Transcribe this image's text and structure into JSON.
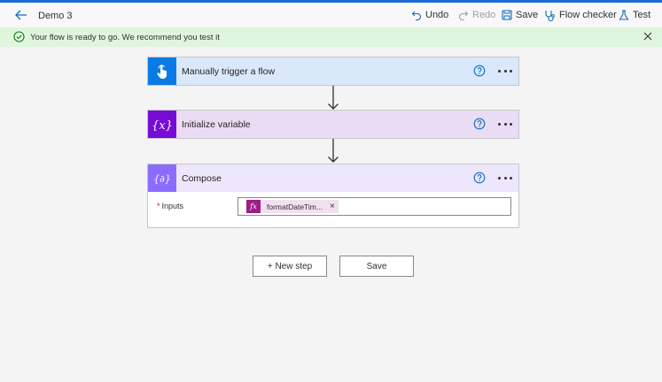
{
  "header": {
    "title": "Demo 3",
    "commands": {
      "undo": "Undo",
      "redo": "Redo",
      "save": "Save",
      "flow_checker": "Flow checker",
      "test": "Test"
    }
  },
  "banner": {
    "message": "Your flow is ready to go. We recommend you test it"
  },
  "steps": [
    {
      "label": "Manually trigger a flow",
      "icon": "hand-touch-icon"
    },
    {
      "label": "Initialize variable",
      "icon": "variable-icon"
    },
    {
      "label": "Compose",
      "icon": "compose-icon"
    }
  ],
  "compose": {
    "inputs_label": "Inputs",
    "required_mark": "*",
    "token_text": "formatDateTim...",
    "token_icon": "fx",
    "token_remove": "×"
  },
  "actions": {
    "new_step": "+ New step",
    "save": "Save"
  },
  "colors": {
    "trigger_accent": "#0a7ae6",
    "variable_accent": "#770bd6",
    "compose_accent": "#8c6cff",
    "banner_bg": "#dff6dd",
    "token_accent": "#9f1c87"
  }
}
